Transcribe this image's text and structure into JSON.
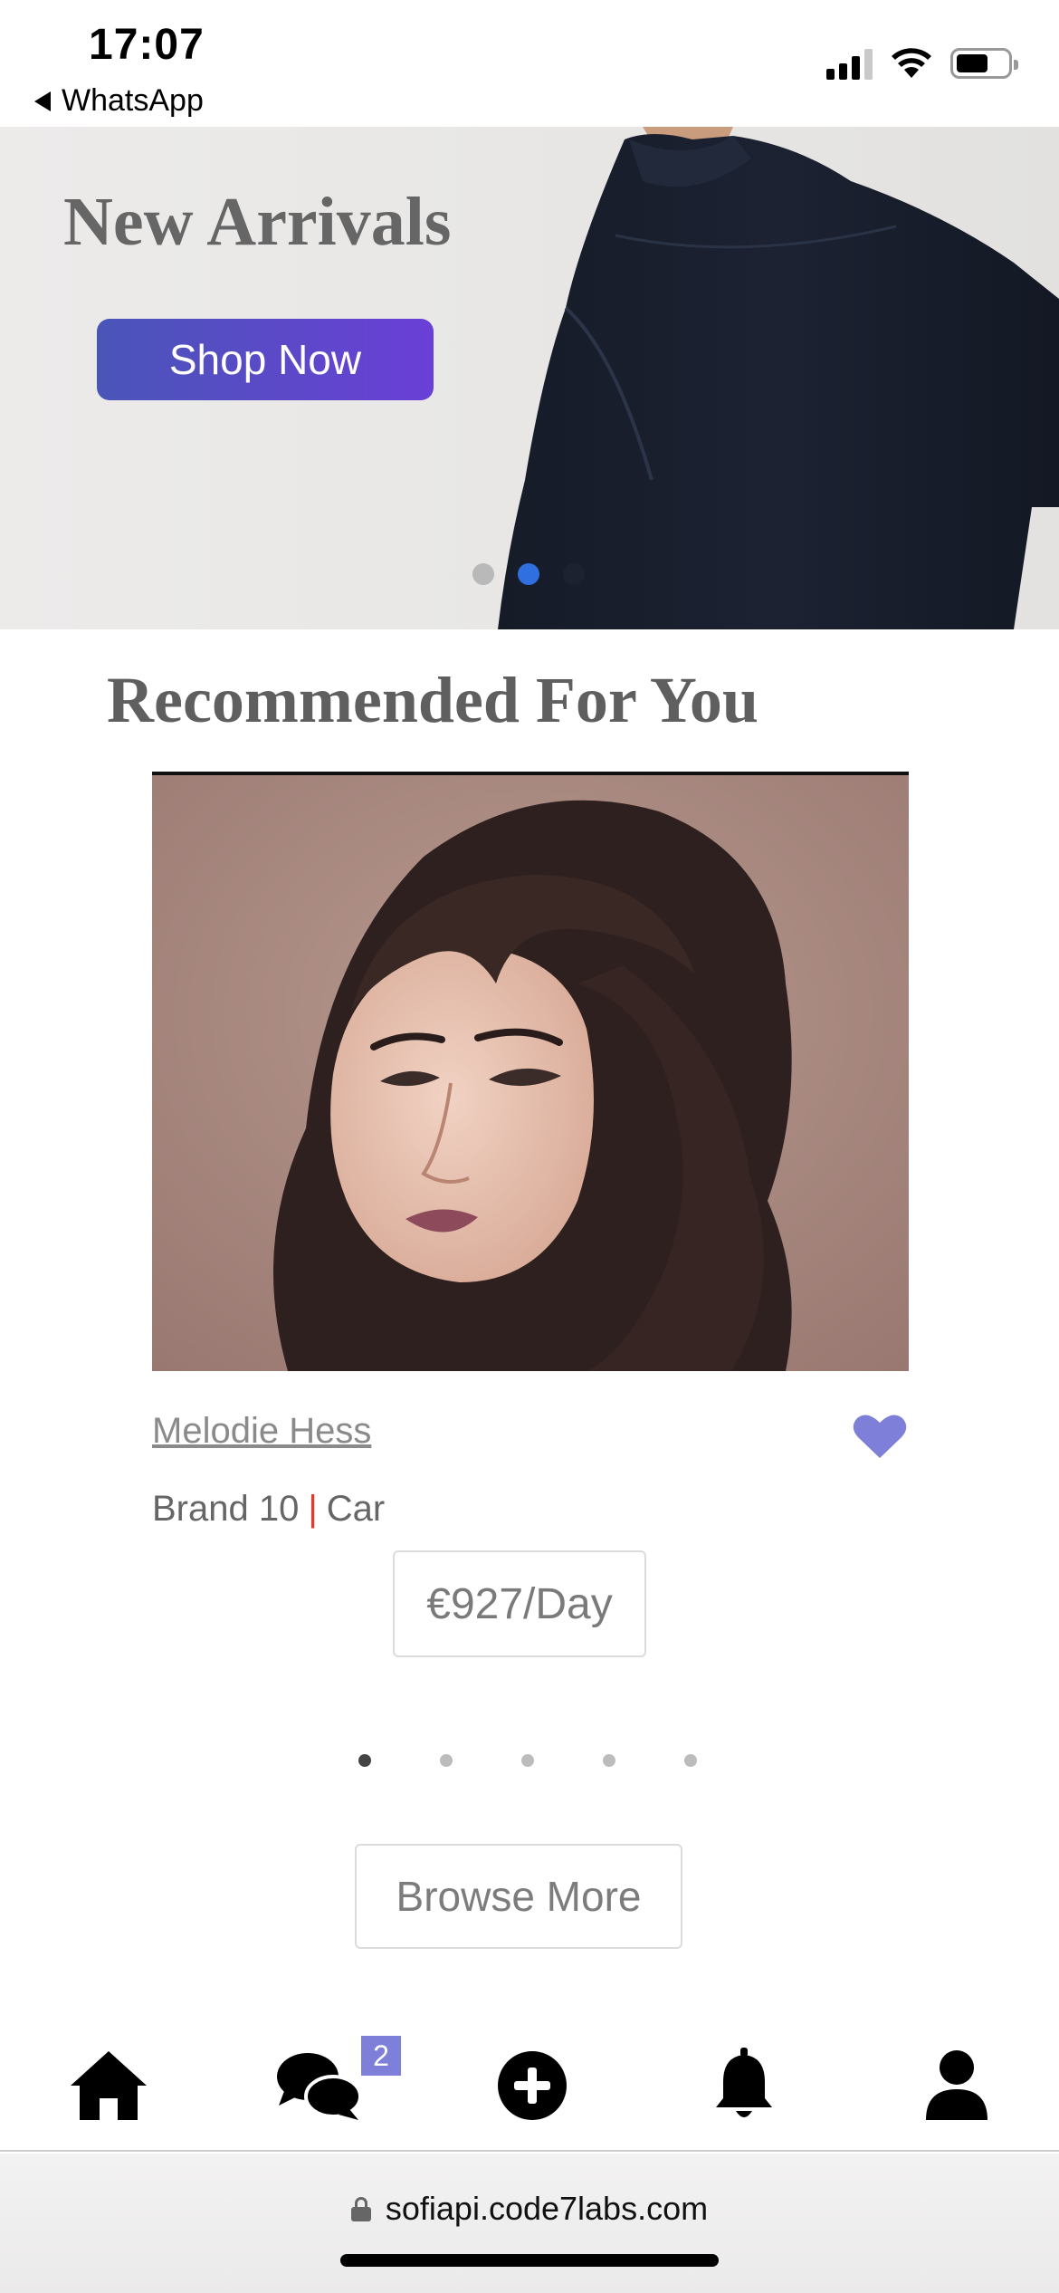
{
  "status_bar": {
    "time": "17:07",
    "back_app": "WhatsApp"
  },
  "hero": {
    "title": "New Arrivals",
    "button_label": "Shop Now",
    "slide_count": 3,
    "active_slide": 2
  },
  "recommended": {
    "title": "Recommended For You",
    "product": {
      "name": "Melodie Hess",
      "brand": "Brand 10",
      "separator": "|",
      "category": "Car",
      "price": "€927/Day",
      "favorited": true
    },
    "carousel_count": 5,
    "carousel_active": 1
  },
  "browse_more_label": "Browse More",
  "bottom_nav": {
    "items": [
      "home-icon",
      "chat-icon",
      "add-icon",
      "bell-icon",
      "user-icon"
    ],
    "chat_badge": "2"
  },
  "url_bar": {
    "domain": "sofiapi.code7labs.com"
  },
  "colors": {
    "accent_gradient_start": "#4a55b8",
    "accent_gradient_end": "#6a3fd6",
    "heart": "#7d7fd8",
    "badge": "#7d7fd8",
    "active_hero_dot": "#2f6fe0"
  }
}
